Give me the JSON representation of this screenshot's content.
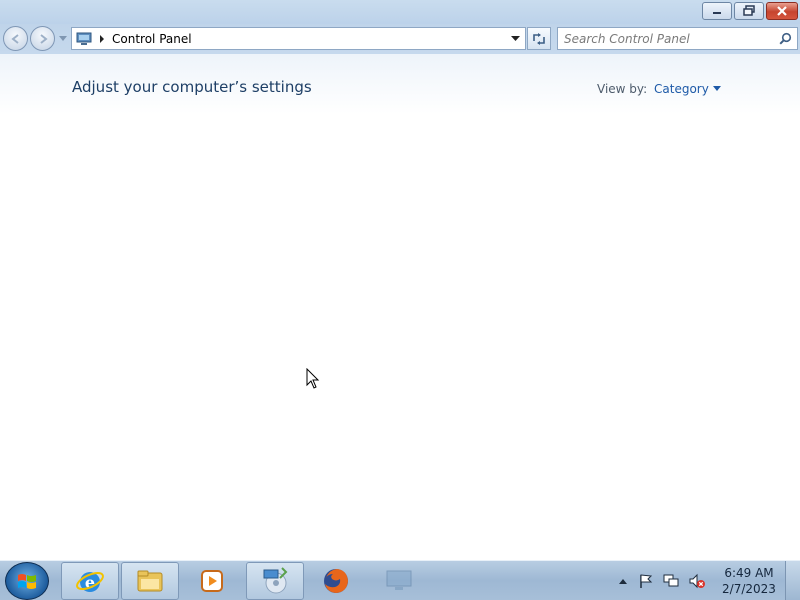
{
  "window": {
    "buttons": {
      "minimize": "minimize-icon",
      "restore": "restore-icon",
      "close": "close-icon"
    }
  },
  "navigation": {
    "address": {
      "icon": "control-panel-icon",
      "path": "Control Panel"
    },
    "search": {
      "placeholder": "Search Control Panel",
      "value": ""
    }
  },
  "main": {
    "title": "Adjust your computer’s settings",
    "view_by": {
      "label": "View by:",
      "value": "Category"
    }
  },
  "taskbar": {
    "start": "windows-start-icon",
    "items": [
      {
        "name": "internet-explorer-icon",
        "pinned": true
      },
      {
        "name": "file-explorer-icon",
        "pinned": true
      },
      {
        "name": "media-player-icon",
        "pinned": false
      },
      {
        "name": "media-center-icon",
        "pinned": true
      },
      {
        "name": "firefox-icon",
        "pinned": false
      },
      {
        "name": "control-panel-icon",
        "pinned": false
      }
    ],
    "tray_icons": [
      "show-hidden-icons",
      "action-center-flag-icon",
      "network-icon",
      "volume-muted-icon"
    ],
    "clock": {
      "time": "6:49 AM",
      "date": "2/7/2023"
    }
  },
  "colors": {
    "title_text": "#1e3f66",
    "link": "#1e5aa8",
    "close_button": "#c6442f"
  }
}
